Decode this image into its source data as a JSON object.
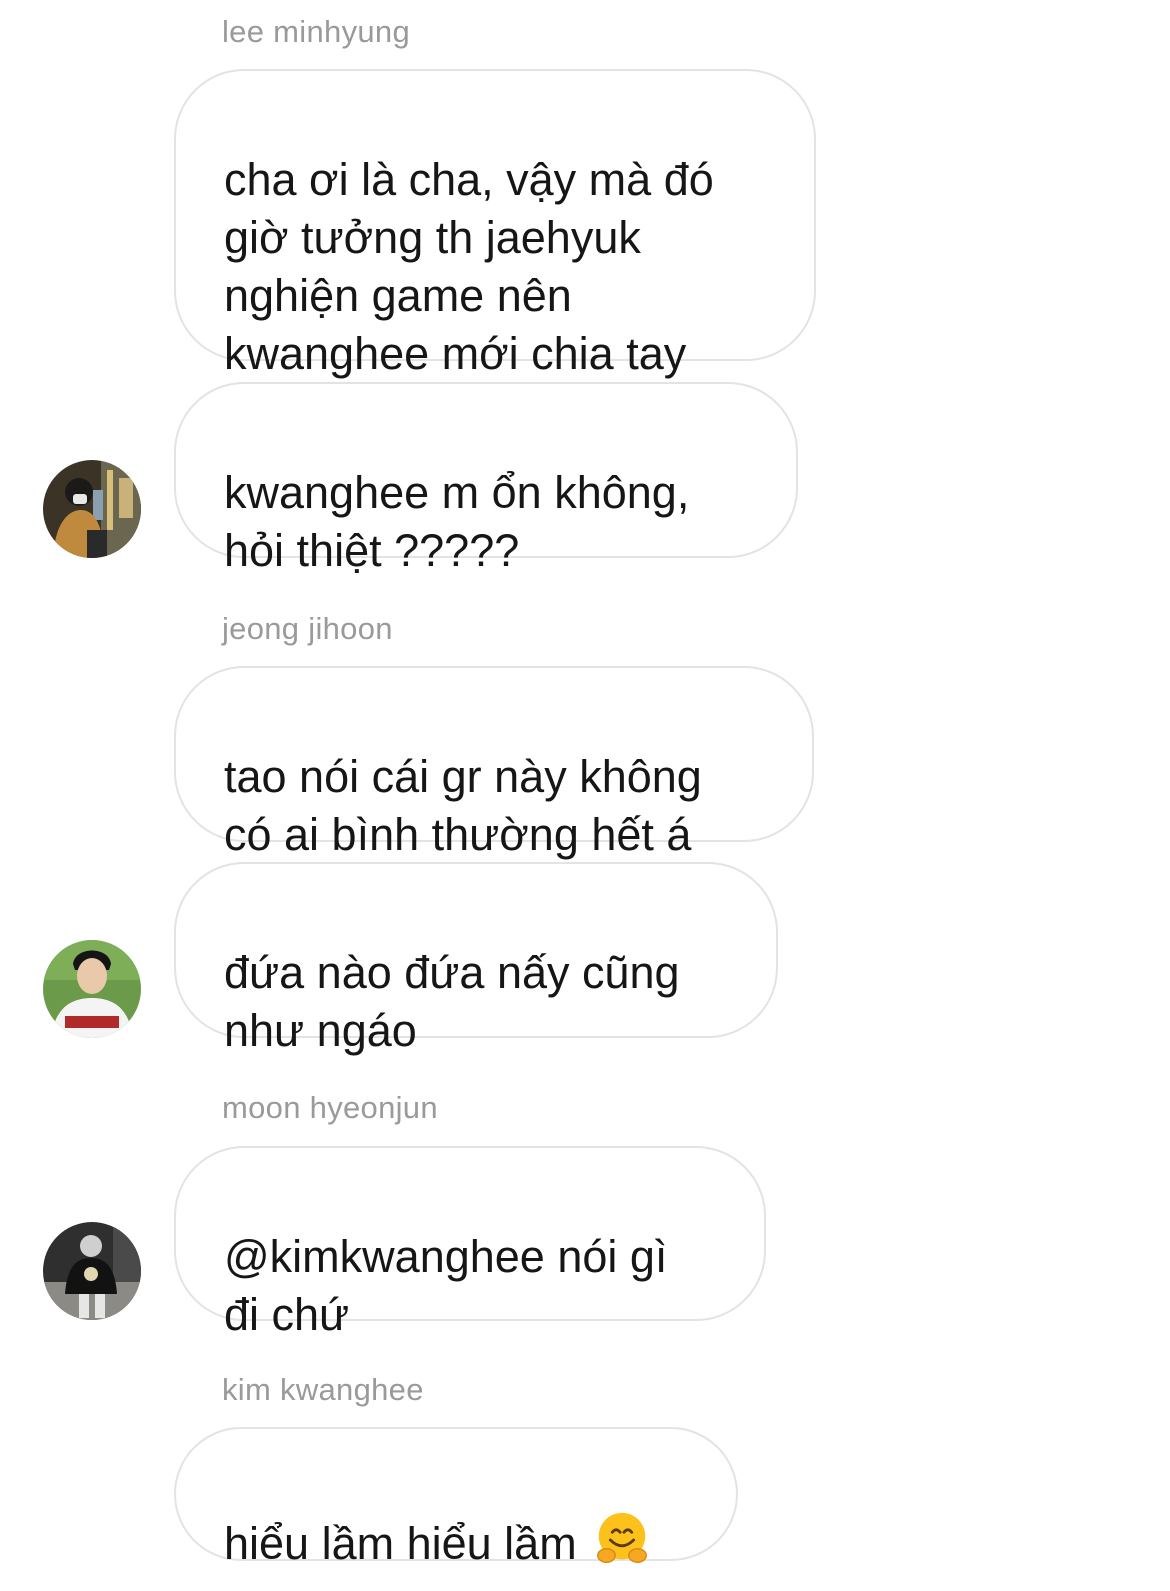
{
  "thread": {
    "groups": [
      {
        "sender": "lee minhyung",
        "messages": [
          "cha ơi là cha, vậy mà đó\ngiờ tưởng th jaehyuk\nnghiện game nên\nkwanghee mới chia tay",
          "kwanghee m ổn không,\nhỏi thiệt ?????"
        ],
        "avatar_icon": "person-photo-avatar-icon"
      },
      {
        "sender": "jeong jihoon",
        "messages": [
          "tao nói cái gr này không\ncó ai bình thường hết á",
          "đứa nào đứa nấy cũng\nnhư ngáo"
        ],
        "avatar_icon": "person-photo-avatar-icon"
      },
      {
        "sender": "moon hyeonjun",
        "messages": [
          "@kimkwanghee nói gì\nđi chứ"
        ],
        "avatar_icon": "person-photo-avatar-icon"
      },
      {
        "sender": "kim kwanghee",
        "messages": [
          "hiểu lầm hiểu lầm"
        ],
        "emoji": "hugging-face-emoji"
      }
    ]
  },
  "colors": {
    "bubble_border": "#e3e3e3",
    "sender_text": "#9a9a9a",
    "message_text": "#161616",
    "background": "#ffffff"
  }
}
